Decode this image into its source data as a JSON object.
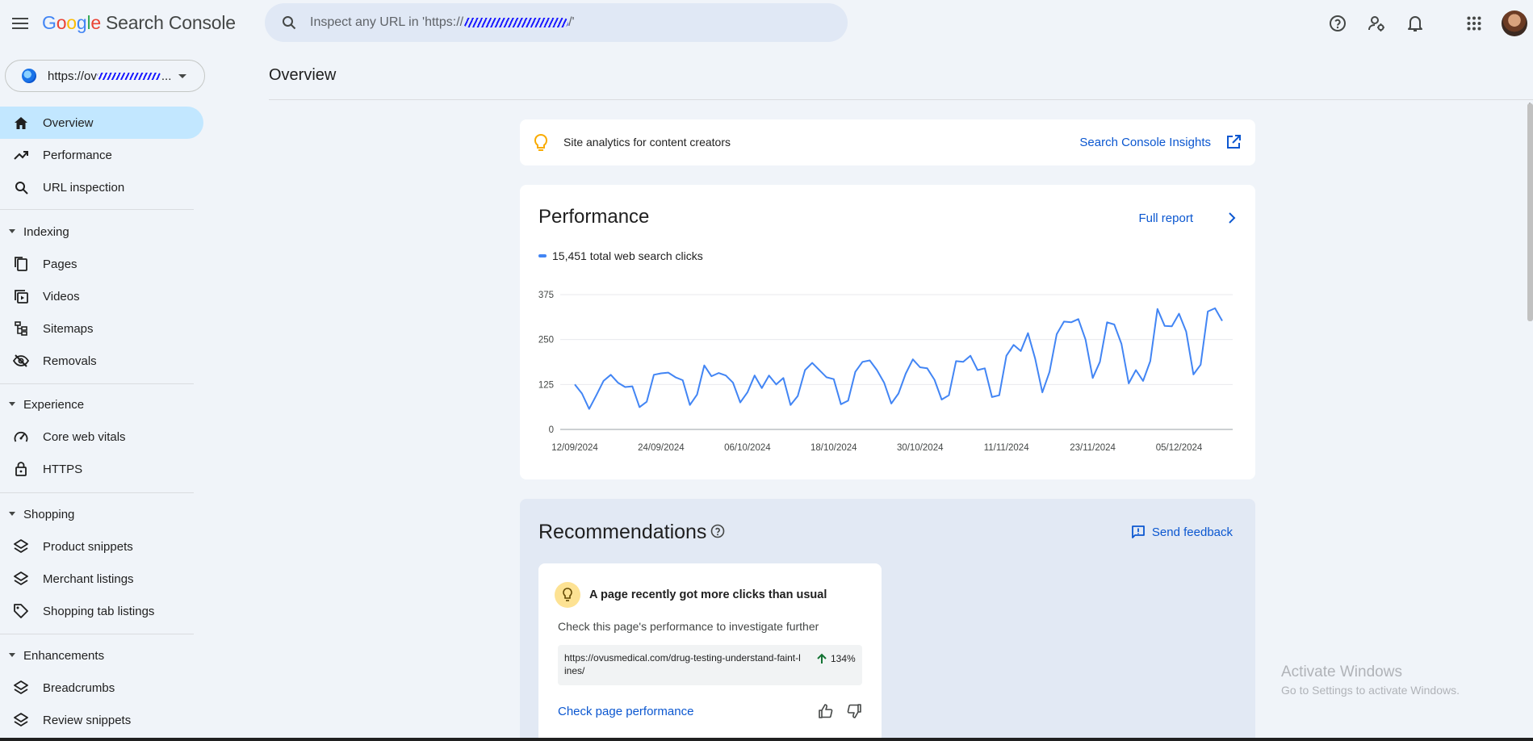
{
  "header": {
    "logo_google": [
      "G",
      "o",
      "o",
      "g",
      "l",
      "e"
    ],
    "product": "Search Console",
    "search_placeholder_prefix": "Inspect any URL in 'https://",
    "search_placeholder_suffix": "/'"
  },
  "property": {
    "label": "https://ov",
    "label_tail": "..."
  },
  "nav": {
    "overview": "Overview",
    "performance": "Performance",
    "url_inspection": "URL inspection",
    "indexing": "Indexing",
    "pages": "Pages",
    "videos": "Videos",
    "sitemaps": "Sitemaps",
    "removals": "Removals",
    "experience": "Experience",
    "core_web_vitals": "Core web vitals",
    "https": "HTTPS",
    "shopping": "Shopping",
    "product_snippets": "Product snippets",
    "merchant_listings": "Merchant listings",
    "shopping_tab_listings": "Shopping tab listings",
    "enhancements": "Enhancements",
    "breadcrumbs": "Breadcrumbs",
    "review_snippets": "Review snippets"
  },
  "main": {
    "page_title": "Overview",
    "insights": {
      "text": "Site analytics for content creators",
      "link": "Search Console Insights"
    },
    "performance": {
      "title": "Performance",
      "full_report": "Full report",
      "legend": "15,451 total web search clicks"
    },
    "recommendations": {
      "title": "Recommendations",
      "feedback": "Send feedback",
      "card": {
        "heading": "A page recently got more clicks than usual",
        "subtext": "Check this page's performance to investigate further",
        "url": "https://ovusmedical.com/drug-testing-understand-faint-lines/",
        "change": "134%",
        "cta": "Check page performance"
      }
    }
  },
  "watermark": {
    "line1": "Activate Windows",
    "line2": "Go to Settings to activate Windows."
  },
  "colors": {
    "accent": "#0b57d0",
    "series": "#4285f4",
    "active_nav": "#c2e7ff",
    "background": "#f0f4f9"
  },
  "chart_data": {
    "type": "line",
    "title": "",
    "xlabel": "",
    "ylabel": "",
    "ylim": [
      0,
      375
    ],
    "yticks": [
      0,
      125,
      250,
      375
    ],
    "xticks": [
      "12/09/2024",
      "24/09/2024",
      "06/10/2024",
      "18/10/2024",
      "30/10/2024",
      "11/11/2024",
      "23/11/2024",
      "05/12/2024"
    ],
    "grid": true,
    "series": [
      {
        "name": "15,451 total web search clicks",
        "color": "#4285f4",
        "x_start": "12/09/2024",
        "x_end": "14/12/2024",
        "values": [
          125,
          100,
          57,
          95,
          135,
          152,
          130,
          118,
          120,
          62,
          77,
          152,
          156,
          158,
          145,
          137,
          68,
          97,
          178,
          148,
          157,
          150,
          130,
          75,
          103,
          150,
          115,
          150,
          125,
          143,
          68,
          93,
          165,
          185,
          165,
          145,
          140,
          70,
          80,
          160,
          188,
          192,
          165,
          130,
          72,
          100,
          155,
          195,
          173,
          170,
          138,
          83,
          95,
          190,
          188,
          205,
          165,
          170,
          90,
          95,
          205,
          235,
          218,
          268,
          197,
          103,
          160,
          265,
          300,
          298,
          307,
          250,
          143,
          188,
          298,
          292,
          238,
          128,
          165,
          135,
          190,
          335,
          288,
          287,
          322,
          272,
          153,
          180,
          328,
          337,
          302
        ]
      }
    ]
  }
}
